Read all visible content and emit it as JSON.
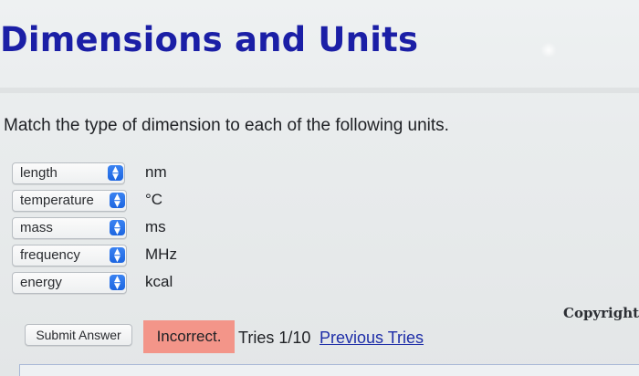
{
  "page": {
    "title": "Dimensions and Units",
    "instructions": "Match the type of dimension to each of the following units."
  },
  "matches": [
    {
      "selected": "length",
      "unit": "nm"
    },
    {
      "selected": "temperature",
      "unit": "°C"
    },
    {
      "selected": "mass",
      "unit": "ms"
    },
    {
      "selected": "frequency",
      "unit": "MHz"
    },
    {
      "selected": "energy",
      "unit": "kcal"
    }
  ],
  "footer": {
    "copyright": "Copyright: L",
    "submit_label": "Submit Answer",
    "status": "Incorrect.",
    "tries": "Tries 1/10",
    "previous_tries_link": "Previous Tries"
  },
  "icons": {
    "dropdown": "chevron-updown-icon"
  },
  "colors": {
    "title": "#1b1fa6",
    "dropdown_accent": "#1d66e1",
    "incorrect_badge": "#f39589",
    "link": "#1e2ea8"
  }
}
